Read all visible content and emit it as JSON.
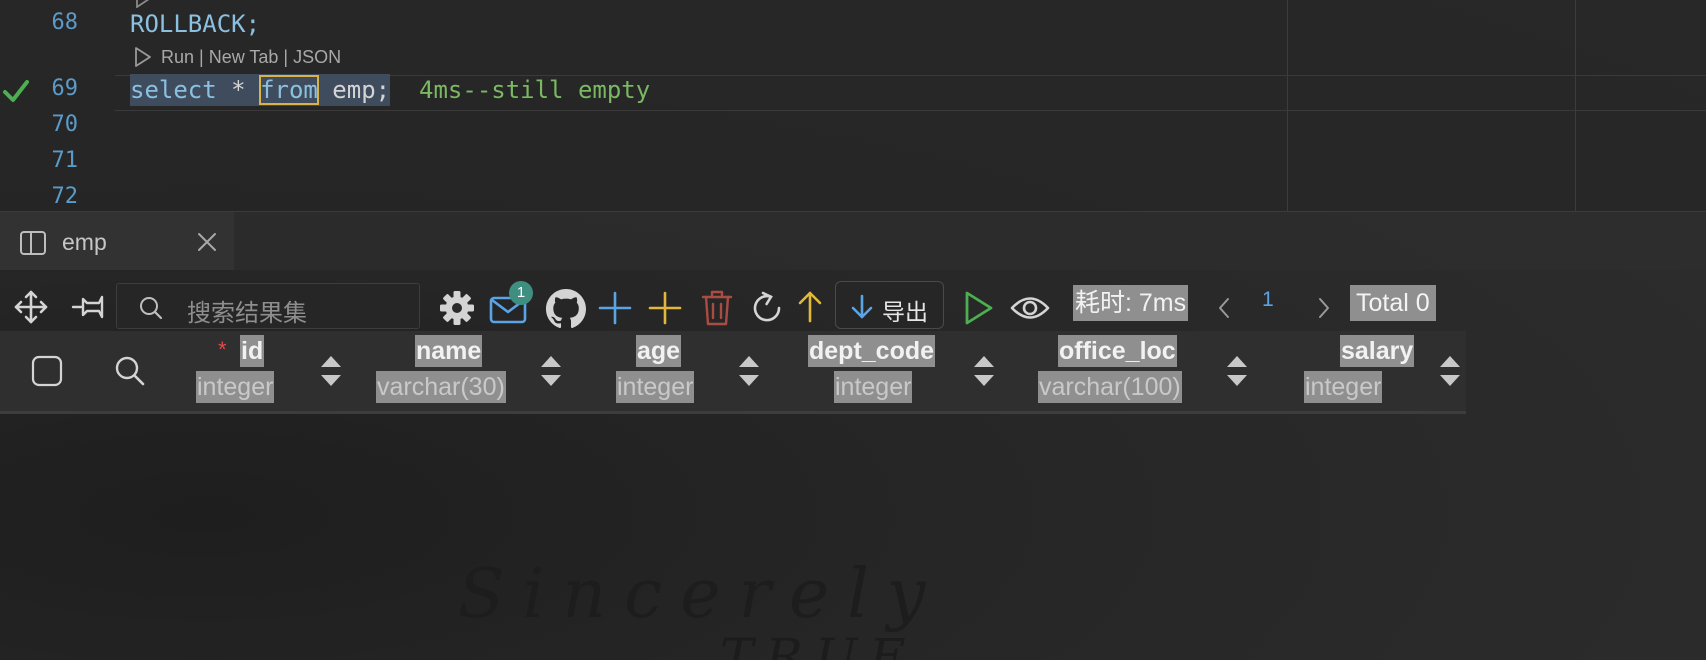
{
  "editor": {
    "lines": [
      {
        "num": "68",
        "text": "ROLLBACK;"
      },
      {
        "num": "69"
      },
      {
        "num": "70"
      },
      {
        "num": "71"
      },
      {
        "num": "72"
      }
    ],
    "codelens": "Run | New Tab | JSON",
    "query": {
      "kw_select": "select",
      "star": " * ",
      "kw_from": "from",
      "rest": " emp;",
      "comment": "4ms--still empty"
    }
  },
  "result_tab": {
    "title": "emp",
    "icons": {
      "split": "split-view-icon",
      "close": "close-icon"
    }
  },
  "toolbar": {
    "search_placeholder": "搜索结果集",
    "mail_badge": "1",
    "export_label": "导出",
    "timing": "耗时: 7ms",
    "page_number": "1",
    "total": "Total 0",
    "icons": [
      "move-icon",
      "pin-icon",
      "search-icon",
      "gear-icon",
      "mail-icon",
      "github-icon",
      "insert-row-icon",
      "add-icon",
      "delete-icon",
      "refresh-icon",
      "import-icon",
      "export-icon",
      "run-icon",
      "eye-icon",
      "chevron-left-icon",
      "chevron-right-icon"
    ]
  },
  "columns": [
    {
      "name": "id",
      "type": "integer",
      "required": "*"
    },
    {
      "name": "name",
      "type": "varchar(30)"
    },
    {
      "name": "age",
      "type": "integer"
    },
    {
      "name": "dept_code",
      "type": "integer"
    },
    {
      "name": "office_loc",
      "type": "varchar(100)"
    },
    {
      "name": "salary",
      "type": "integer"
    }
  ],
  "watermark": {
    "line1": "Sincerely",
    "line2": "TRUE"
  },
  "colors": {
    "accent_blue": "#5aa4e6",
    "success_green": "#4caf50",
    "add_yellow": "#e1b83a",
    "delete_red": "#a94c43",
    "badge_teal": "#3f8f80"
  }
}
